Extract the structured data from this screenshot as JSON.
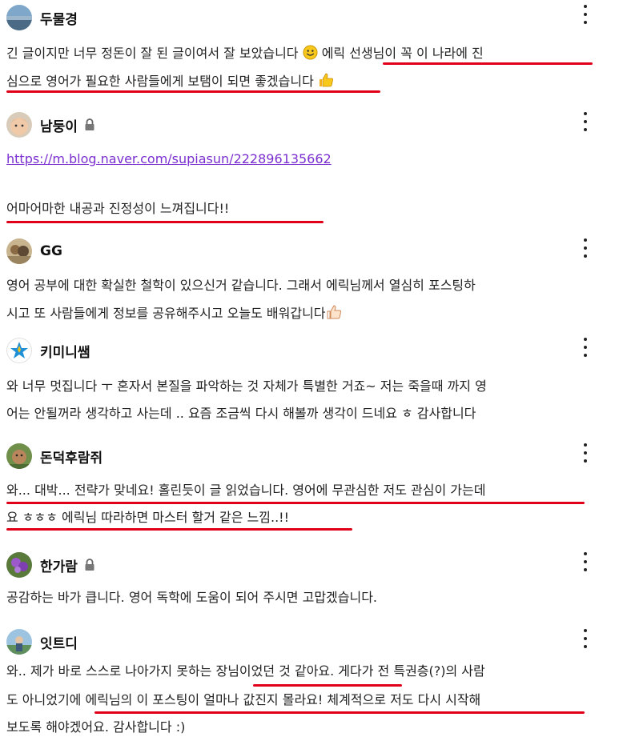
{
  "comments": [
    {
      "name": "두물경",
      "locked": false,
      "lines": [
        "긴 글이지만 너무 정돈이 잘 된 글이여서 잘 보았습니다 ",
        " 에릭 선생님이 꼭 이 나라에 진",
        "심으로 영어가 필요한 사람들에게 보탬이 되면 좋겠습니다 "
      ]
    },
    {
      "name": "남둥이",
      "locked": true,
      "link": "https://m.blog.naver.com/supiasun/222896135662",
      "lines": [
        "어마어마한 내공과 진정성이 느껴집니다!!"
      ]
    },
    {
      "name": "GG",
      "locked": false,
      "lines": [
        "영어 공부에 대한 확실한 철학이 있으신거 같습니다. 그래서 에릭님께서 열심히 포스팅하",
        "시고 또 사람들에게 정보를 공유해주시고 오늘도 배워갑니다"
      ]
    },
    {
      "name": "키미니쌤",
      "locked": false,
      "lines": [
        "와 너무 멋집니다 ㅜ 혼자서 본질을 파악하는 것 자체가 특별한 거죠~ 저는 죽을때 까지 영",
        "어는 안될꺼라 생각하고 사는데 .. 요즘 조금씩 다시 해볼까 생각이 드네요 ㅎ 감사합니다"
      ]
    },
    {
      "name": "돈덕후람쥐",
      "locked": false,
      "lines": [
        "와... 대박... 전략가 맞네요! 홀린듯이 글 읽었습니다. 영어에 무관심한 저도 관심이 가는데",
        "요 ㅎㅎㅎ 에릭님 따라하면 마스터 할거 같은 느낌..!!"
      ]
    },
    {
      "name": "한가람",
      "locked": true,
      "lines": [
        "공감하는 바가 큽니다. 영어 독학에 도움이 되어 주시면 고맙겠습니다."
      ]
    },
    {
      "name": "잇트디",
      "locked": false,
      "lines": [
        "와.. 제가 바로 스스로 나아가지 못하는 장님이었던 것 같아요. 게다가 전 특권층(?)의 사람",
        "도 아니었기에 에릭님의 이 포스팅이 얼마나 값진지 몰라요! 체계적으로 저도 다시 시작해",
        "보도록 해야겠어요. 감사합니다 :)"
      ]
    }
  ],
  "colors": {
    "underline": "#e0001a",
    "link": "#7b2fd0",
    "text": "#222222"
  }
}
